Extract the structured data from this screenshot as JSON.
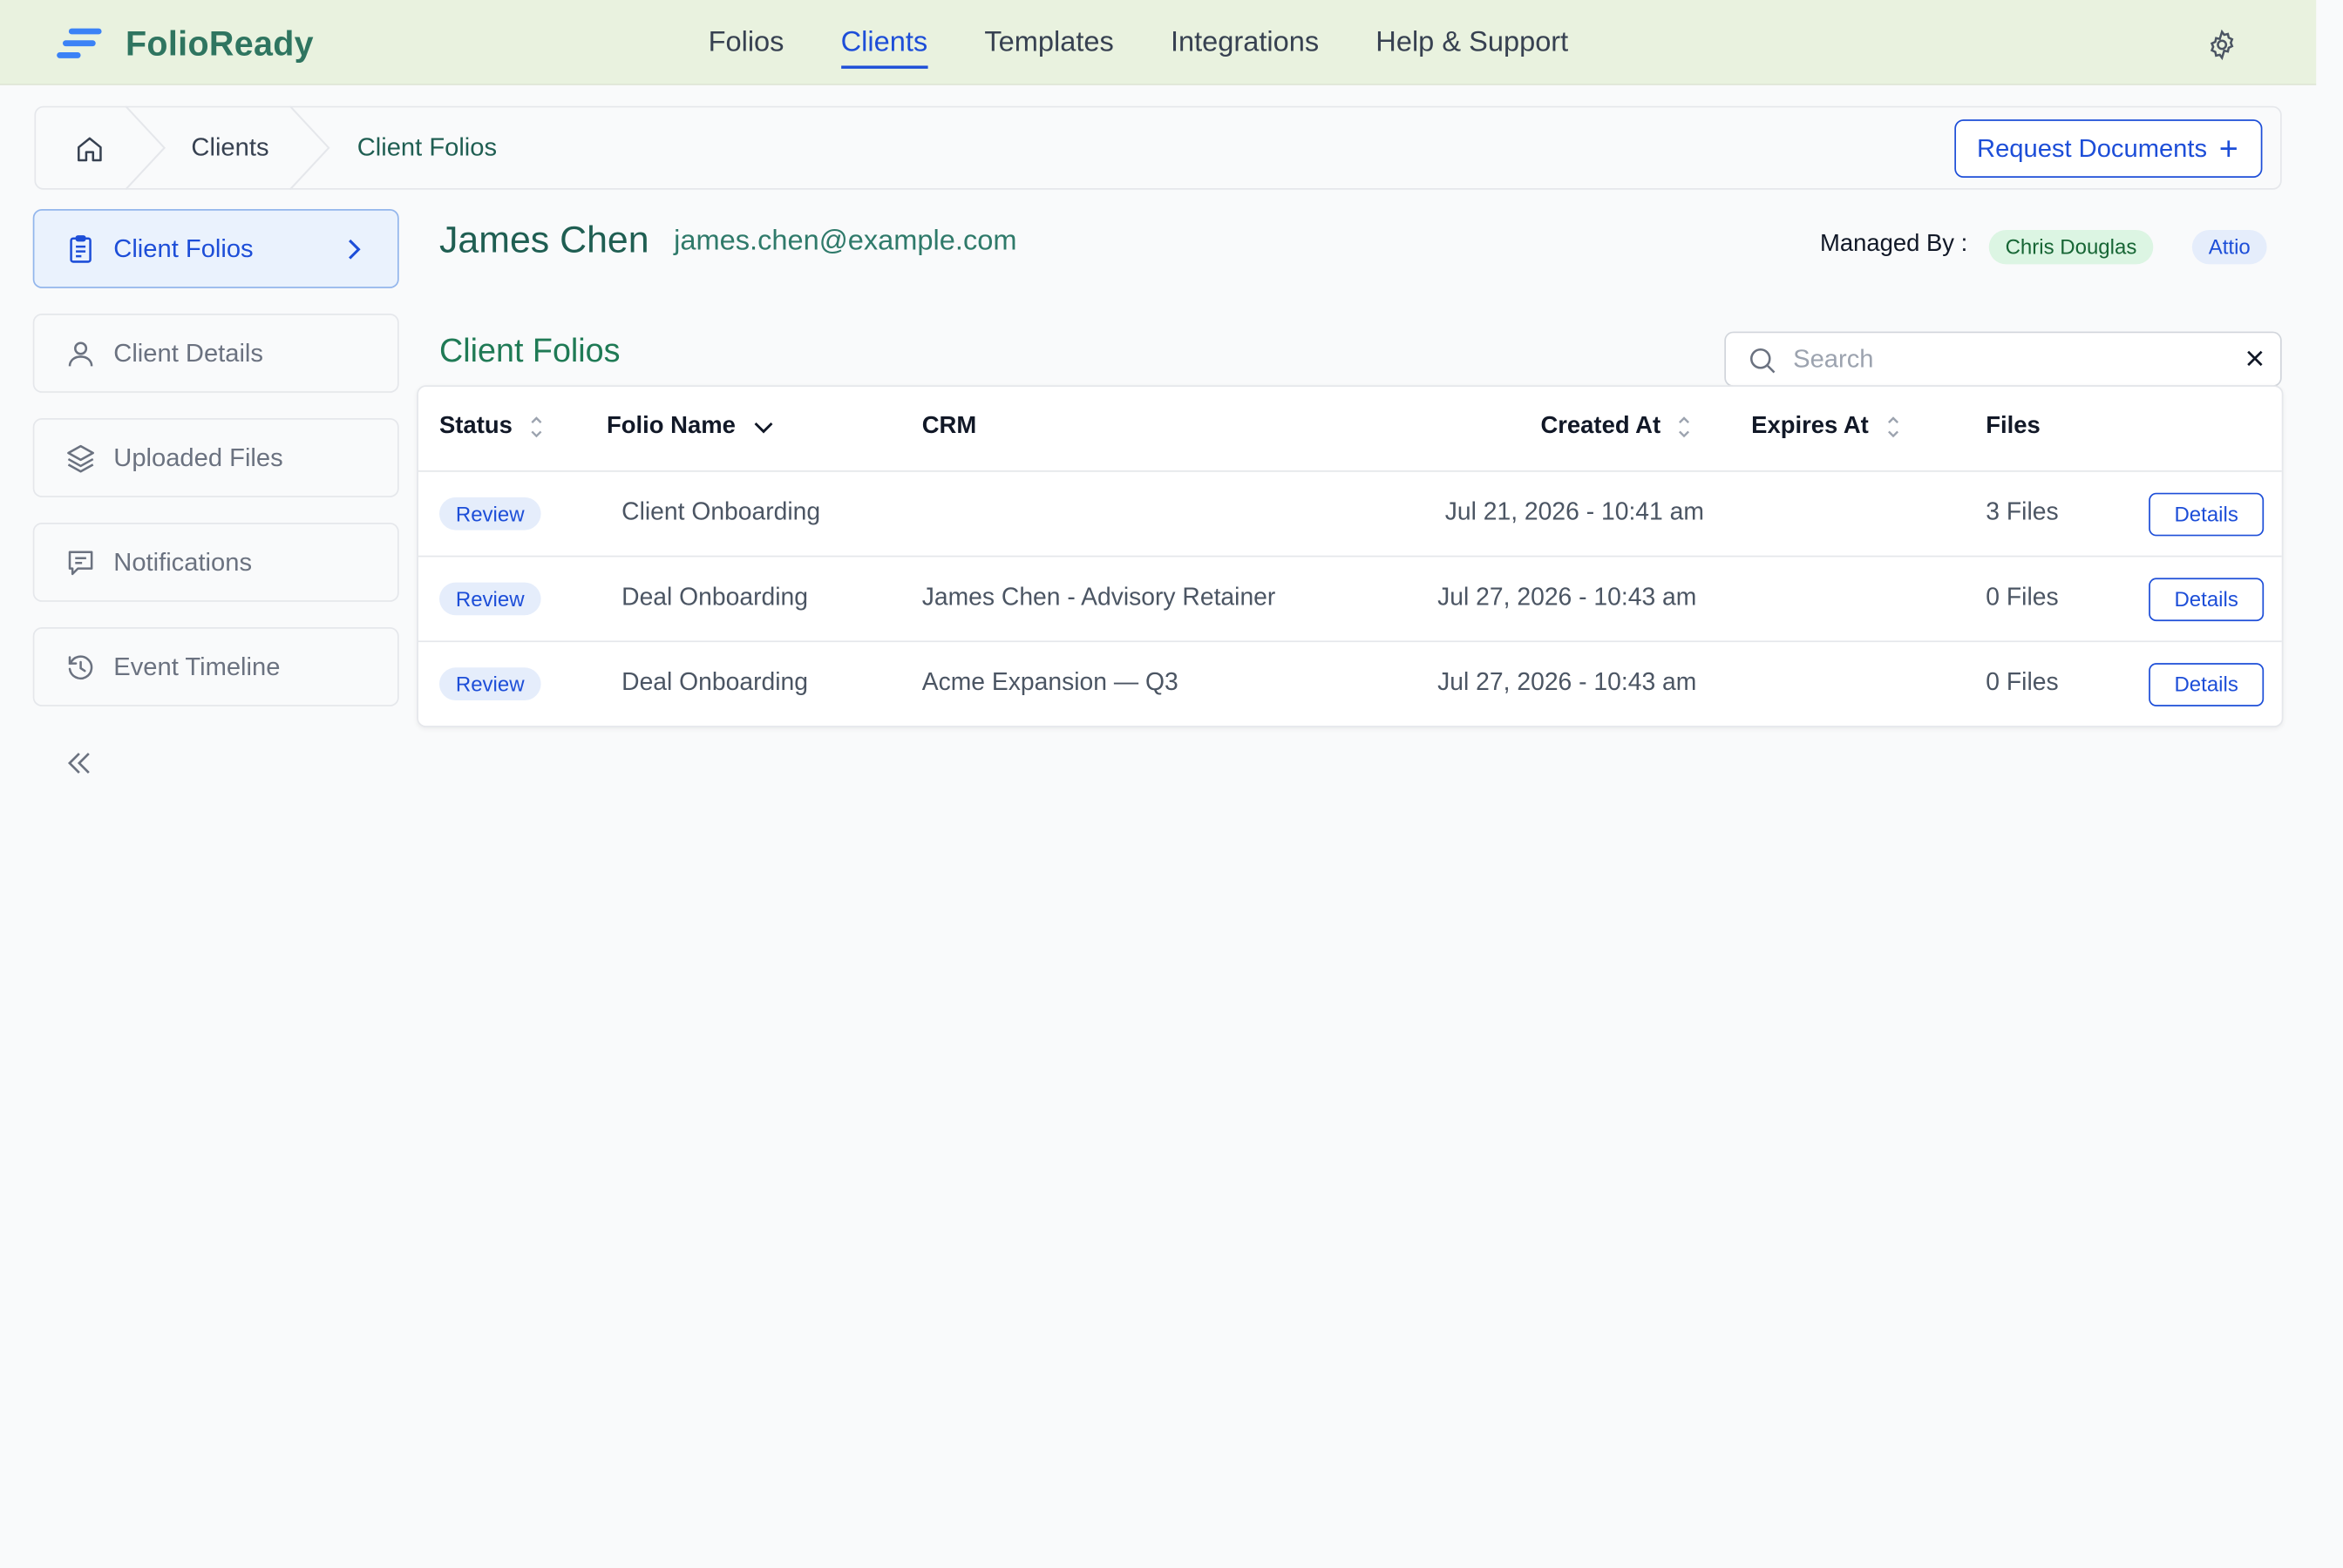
{
  "app": {
    "name": "FolioReady",
    "brand_color": "#2f7560",
    "accent_color": "#1d4ed8"
  },
  "nav": {
    "links": [
      "Folios",
      "Clients",
      "Templates",
      "Integrations",
      "Help & Support"
    ],
    "active": "Clients",
    "settings_icon": "gear-icon"
  },
  "breadcrumb": {
    "items": [
      "Clients",
      "Client Folios"
    ],
    "home_icon": "home-icon"
  },
  "actions": {
    "request_documents": "Request Documents"
  },
  "sidebar": {
    "items": [
      {
        "label": "Client Folios",
        "icon": "clipboard-icon",
        "active": true
      },
      {
        "label": "Client Details",
        "icon": "user-icon",
        "active": false
      },
      {
        "label": "Uploaded Files",
        "icon": "layers-icon",
        "active": false
      },
      {
        "label": "Notifications",
        "icon": "message-icon",
        "active": false
      },
      {
        "label": "Event Timeline",
        "icon": "history-icon",
        "active": false
      }
    ],
    "collapse_icon": "double-chevron-left-icon"
  },
  "client": {
    "name": "James Chen",
    "email": "james.chen@example.com",
    "managed_by_label": "Managed By :",
    "manager": "Chris Douglas",
    "crm_tag": "Attio"
  },
  "folios": {
    "title": "Client Folios",
    "search": {
      "placeholder": "Search",
      "value": ""
    },
    "columns": [
      "Status",
      "Folio Name",
      "CRM",
      "Created At",
      "Expires At",
      "Files"
    ],
    "rows": [
      {
        "status": "Review",
        "folio_name": "Client Onboarding",
        "crm": "",
        "created_at": "Jul 21, 2026 - 10:41 am",
        "expires_at": "",
        "files": "3 Files",
        "action": "Details"
      },
      {
        "status": "Review",
        "folio_name": "Deal Onboarding",
        "crm": "James Chen - Advisory Retainer",
        "created_at": "Jul 27, 2026 - 10:43 am",
        "expires_at": "",
        "files": "0 Files",
        "action": "Details"
      },
      {
        "status": "Review",
        "folio_name": "Deal Onboarding",
        "crm": "Acme Expansion — Q3",
        "created_at": "Jul 27, 2026 - 10:43 am",
        "expires_at": "",
        "files": "0 Files",
        "action": "Details"
      }
    ]
  }
}
